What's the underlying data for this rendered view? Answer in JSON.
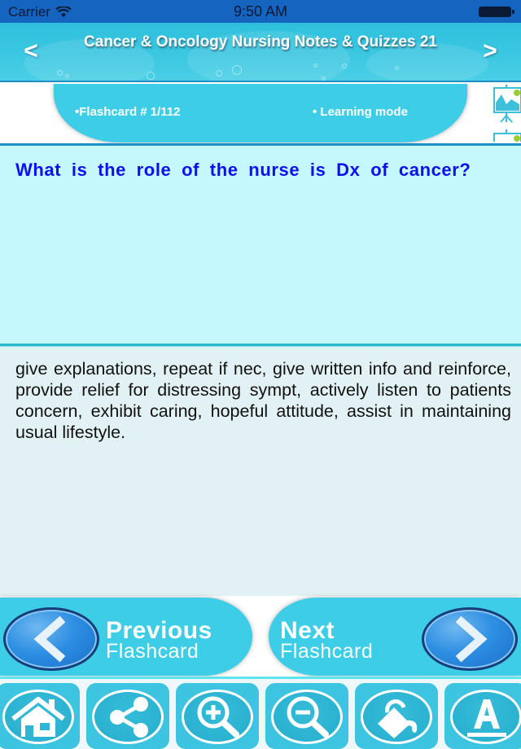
{
  "status_bar": {
    "carrier": "Carrier",
    "time": "9:50 AM",
    "wifi_icon": "wifi-icon",
    "battery_icon": "battery-icon"
  },
  "header": {
    "title": "Cancer & Oncology Nursing Notes & Quizzes 21",
    "prev_arrow": "<",
    "next_arrow": ">"
  },
  "info": {
    "counter": "•Flashcard #  1/112",
    "mode": "• Learning mode",
    "side_icon": "presentation-chart-icon"
  },
  "flashcard": {
    "question": "What is the role of the nurse is Dx of cancer?",
    "answer": "give explanations, repeat if nec, give written info and reinforce, provide relief for distressing sympt, actively listen to patients concern, exhibit caring, hopeful attitude, assist in maintaining usual lifestyle."
  },
  "navigation": {
    "previous": {
      "big": "Previous",
      "small": "Flashcard",
      "icon": "chevron-left-icon"
    },
    "next": {
      "big": "Next",
      "small": "Flashcard",
      "icon": "chevron-right-icon"
    }
  },
  "toolbar": {
    "items": [
      {
        "name": "home",
        "icon": "home-icon"
      },
      {
        "name": "share",
        "icon": "share-icon"
      },
      {
        "name": "zoom-in",
        "icon": "zoom-in-icon"
      },
      {
        "name": "zoom-out",
        "icon": "zoom-out-icon"
      },
      {
        "name": "background-color",
        "icon": "paint-bucket-icon"
      },
      {
        "name": "font",
        "icon": "font-icon"
      }
    ]
  },
  "colors": {
    "status_bar": "#1565c0",
    "header": "#3cc8e2",
    "accent": "#3ecde6",
    "question_bg": "#c5f8fc",
    "question_text": "#0d0ff0",
    "answer_bg": "#e2f1f3",
    "answer_text": "#111111"
  }
}
